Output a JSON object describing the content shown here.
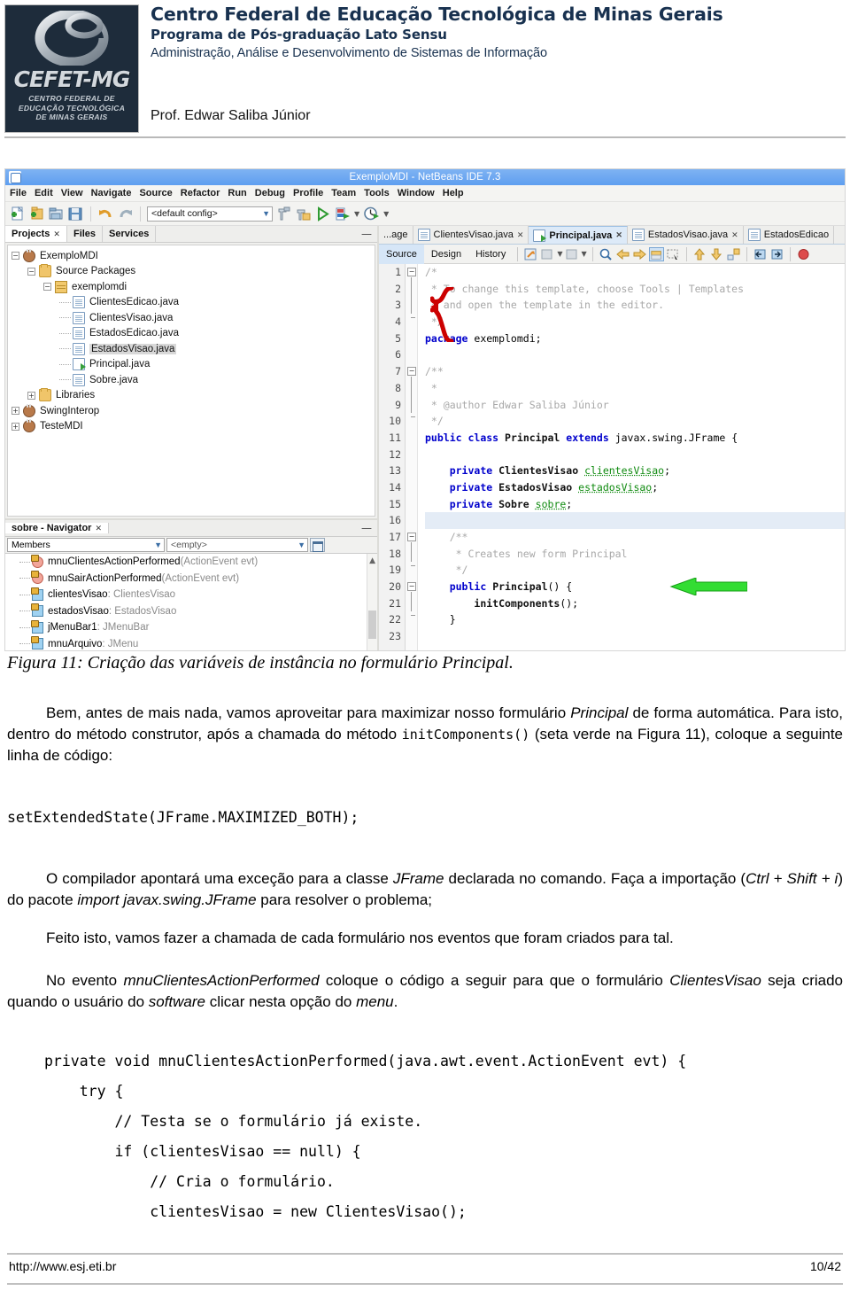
{
  "header": {
    "institution": "Centro Federal de Educação Tecnológica de Minas Gerais",
    "program": "Programa de Pós-graduação Lato Sensu",
    "course": "Administração, Análise e Desenvolvimento de Sistemas de Informação",
    "professor": "Prof. Edwar Saliba Júnior",
    "logo": {
      "wordmark": "CEFET-MG",
      "line1": "CENTRO FEDERAL DE",
      "line2": "EDUCAÇÃO TECNOLÓGICA",
      "line3": "DE MINAS GERAIS",
      "bg_color": "#1e2c3b",
      "text_color": "#d3d8dd"
    }
  },
  "screenshot": {
    "window_title": "ExemploMDI - NetBeans IDE 7.3",
    "titlebar_color": "#66a3ee",
    "menubar": [
      "File",
      "Edit",
      "View",
      "Navigate",
      "Source",
      "Refactor",
      "Run",
      "Debug",
      "Profile",
      "Team",
      "Tools",
      "Window",
      "Help"
    ],
    "toolbar": {
      "config_combo_value": "<default config>",
      "icons": [
        "new-file-icon",
        "new-project-icon",
        "open-project-icon",
        "save-all-icon",
        "undo-icon",
        "redo-icon",
        "build-icon",
        "clean-build-icon",
        "run-icon",
        "debug-icon",
        "profile-icon"
      ]
    },
    "explorer": {
      "tabs": [
        {
          "label": "Projects",
          "active": true,
          "closable": true
        },
        {
          "label": "Files",
          "active": false,
          "closable": false
        },
        {
          "label": "Services",
          "active": false,
          "closable": false
        }
      ],
      "minimize_label": "—",
      "tree": [
        {
          "label": "ExemploMDI",
          "depth": 0,
          "toggle": "-",
          "icon": "coffee-cup-icon"
        },
        {
          "label": "Source Packages",
          "depth": 1,
          "toggle": "-",
          "icon": "package-folder-icon"
        },
        {
          "label": "exemplomdi",
          "depth": 2,
          "toggle": "-",
          "icon": "java-package-icon"
        },
        {
          "label": "ClientesEdicao.java",
          "depth": 3,
          "toggle": "",
          "icon": "java-file-icon"
        },
        {
          "label": "ClientesVisao.java",
          "depth": 3,
          "toggle": "",
          "icon": "java-file-icon"
        },
        {
          "label": "EstadosEdicao.java",
          "depth": 3,
          "toggle": "",
          "icon": "java-file-icon"
        },
        {
          "label": "EstadosVisao.java",
          "depth": 3,
          "toggle": "",
          "icon": "java-file-icon",
          "selected": true
        },
        {
          "label": "Principal.java",
          "depth": 3,
          "toggle": "",
          "icon": "java-main-file-icon"
        },
        {
          "label": "Sobre.java",
          "depth": 3,
          "toggle": "",
          "icon": "java-file-icon"
        },
        {
          "label": "Libraries",
          "depth": 1,
          "toggle": "+",
          "icon": "libraries-folder-icon"
        },
        {
          "label": "SwingInterop",
          "depth": 0,
          "toggle": "+",
          "icon": "coffee-cup-icon"
        },
        {
          "label": "TesteMDI",
          "depth": 0,
          "toggle": "+",
          "icon": "coffee-cup-icon"
        }
      ]
    },
    "navigator": {
      "tab_label": "sobre - Navigator",
      "minimize_label": "—",
      "filter_value": "Members",
      "scope_value": "<empty>",
      "members": [
        {
          "name": "mnuClientesActionPerformed",
          "signature": "(ActionEvent evt)",
          "icon": "method-icon"
        },
        {
          "name": "mnuSairActionPerformed",
          "signature": "(ActionEvent evt)",
          "icon": "method-icon"
        },
        {
          "name": "clientesVisao",
          "signature": " : ClientesVisao",
          "icon": "field-icon"
        },
        {
          "name": "estadosVisao",
          "signature": " : EstadosVisao",
          "icon": "field-icon"
        },
        {
          "name": "jMenuBar1",
          "signature": " : JMenuBar",
          "icon": "field-icon"
        },
        {
          "name": "mnuArquivo",
          "signature": " : JMenu",
          "icon": "field-icon"
        }
      ]
    },
    "editor": {
      "tabs": [
        {
          "label": "...age",
          "active": false,
          "closable": false,
          "icon": ""
        },
        {
          "label": "ClientesVisao.java",
          "active": false,
          "closable": true,
          "icon": "java-file-icon"
        },
        {
          "label": "Principal.java",
          "active": true,
          "closable": true,
          "icon": "java-main-file-icon"
        },
        {
          "label": "EstadosVisao.java",
          "active": false,
          "closable": true,
          "icon": "java-file-icon"
        },
        {
          "label": "EstadosEdicao",
          "active": false,
          "closable": false,
          "icon": "java-file-icon"
        }
      ],
      "view_buttons": [
        {
          "label": "Source",
          "active": true
        },
        {
          "label": "Design",
          "active": false
        },
        {
          "label": "History",
          "active": false
        }
      ],
      "lines": [
        {
          "n": 1,
          "text": "/*",
          "style": "cmt",
          "fold": "-"
        },
        {
          "n": 2,
          "text": " * To change this template, choose Tools | Templates",
          "style": "cmt"
        },
        {
          "n": 3,
          "text": " * and open the template in the editor.",
          "style": "cmt"
        },
        {
          "n": 4,
          "text": " */",
          "style": "cmt",
          "fold": "end"
        },
        {
          "n": 5,
          "text": "package exemplomdi;",
          "style": "code"
        },
        {
          "n": 6,
          "text": "",
          "style": "code"
        },
        {
          "n": 7,
          "text": "/**",
          "style": "cmt",
          "fold": "-"
        },
        {
          "n": 8,
          "text": " *",
          "style": "cmt"
        },
        {
          "n": 9,
          "text": " * @author Edwar Saliba Júnior",
          "style": "cmt"
        },
        {
          "n": 10,
          "text": " */",
          "style": "cmt",
          "fold": "end"
        },
        {
          "n": 11,
          "text": "public class Principal extends javax.swing.JFrame {",
          "style": "code"
        },
        {
          "n": 12,
          "text": "",
          "style": "code"
        },
        {
          "n": 13,
          "text": "    private ClientesVisao clientesVisao;",
          "style": "code"
        },
        {
          "n": 14,
          "text": "    private EstadosVisao estadosVisao;",
          "style": "code"
        },
        {
          "n": 15,
          "text": "    private Sobre sobre;",
          "style": "code"
        },
        {
          "n": 16,
          "text": "",
          "style": "code",
          "highlight": true
        },
        {
          "n": 17,
          "text": "    /**",
          "style": "cmt",
          "fold": "-"
        },
        {
          "n": 18,
          "text": "     * Creates new form Principal",
          "style": "cmt"
        },
        {
          "n": 19,
          "text": "     */",
          "style": "cmt",
          "fold": "end"
        },
        {
          "n": 20,
          "text": "    public Principal() {",
          "style": "code",
          "fold": "-"
        },
        {
          "n": 21,
          "text": "        initComponents();",
          "style": "code"
        },
        {
          "n": 22,
          "text": "    }",
          "style": "code",
          "fold": "end"
        },
        {
          "n": 23,
          "text": "",
          "style": "code"
        }
      ],
      "annotations": {
        "red_brace": {
          "color": "#cc0000",
          "covers_lines": "13-15"
        },
        "green_arrow": {
          "color": "#2fd02f",
          "points_to_line": 21
        }
      }
    }
  },
  "figure_caption": "Figura 11: Criação das variáveis de instância no formulário Principal.",
  "paragraphs": {
    "p1_a": "Bem, antes de mais nada, vamos aproveitar para maximizar nosso formulário ",
    "p1_i1": "Principal",
    "p1_b": " de forma automática. Para isto, dentro do método construtor, após a chamada do método ",
    "p1_code": "initComponents()",
    "p1_c": " (seta verde na Figura 11), coloque a seguinte linha de código:",
    "code1": "setExtendedState(JFrame.MAXIMIZED_BOTH);",
    "p2_a": "O compilador apontará uma exceção para a classe ",
    "p2_i1": "JFrame",
    "p2_b": " declarada no comando. Faça a importação (",
    "p2_i2": "Ctrl + Shift + i",
    "p2_c": ") do pacote ",
    "p2_i3": "import javax.swing.JFrame",
    "p2_d": " para resolver o problema;",
    "p3": "Feito isto, vamos fazer a chamada de cada formulário nos eventos que foram criados para tal.",
    "p4_a": "No evento ",
    "p4_i1": "mnuClientesActionPerformed",
    "p4_b": " coloque o código a seguir para que o formulário ",
    "p4_i2": "ClientesVisao",
    "p4_c": " seja criado quando o usuário do ",
    "p4_i3": "software",
    "p4_d": " clicar nesta opção do ",
    "p4_i4": "menu",
    "p4_e": "."
  },
  "code_block": [
    "private void mnuClientesActionPerformed(java.awt.event.ActionEvent evt) {",
    "    try {",
    "        // Testa se o formulário já existe.",
    "        if (clientesVisao == null) {",
    "            // Cria o formulário.",
    "            clientesVisao = new ClientesVisao();"
  ],
  "footer": {
    "url": "http://www.esj.eti.br",
    "page": "10/42"
  }
}
